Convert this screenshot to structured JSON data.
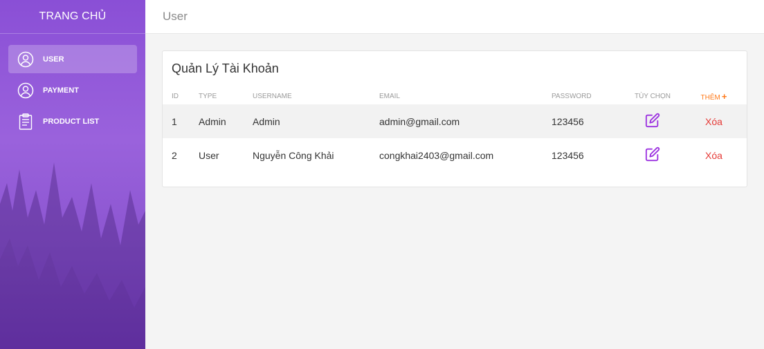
{
  "sidebar": {
    "brand": "TRANG CHỦ",
    "items": [
      {
        "label": "USER",
        "icon": "user-circle-icon",
        "active": true
      },
      {
        "label": "PAYMENT",
        "icon": "user-circle-icon",
        "active": false
      },
      {
        "label": "PRODUCT LIST",
        "icon": "clipboard-icon",
        "active": false
      }
    ]
  },
  "header": {
    "title": "User"
  },
  "main": {
    "card_title": "Quản Lý Tài Khoản",
    "columns": [
      "ID",
      "TYPE",
      "USERNAME",
      "EMAIL",
      "PASSWORD",
      "TÙY CHỌN",
      "THÊM"
    ],
    "add_icon": "plus-icon",
    "rows": [
      {
        "id": "1",
        "type": "Admin",
        "username": "Admin",
        "email": "admin@gmail.com",
        "password": "123456",
        "delete_label": "Xóa"
      },
      {
        "id": "2",
        "type": "User",
        "username": "Nguyễn Công Khải",
        "email": "congkhai2403@gmail.com",
        "password": "123456",
        "delete_label": "Xóa"
      }
    ]
  },
  "colors": {
    "sidebar_accent": "#8a4fd6",
    "edit_icon": "#9b30e0",
    "delete": "#e53935",
    "add": "#ff7a1a"
  }
}
